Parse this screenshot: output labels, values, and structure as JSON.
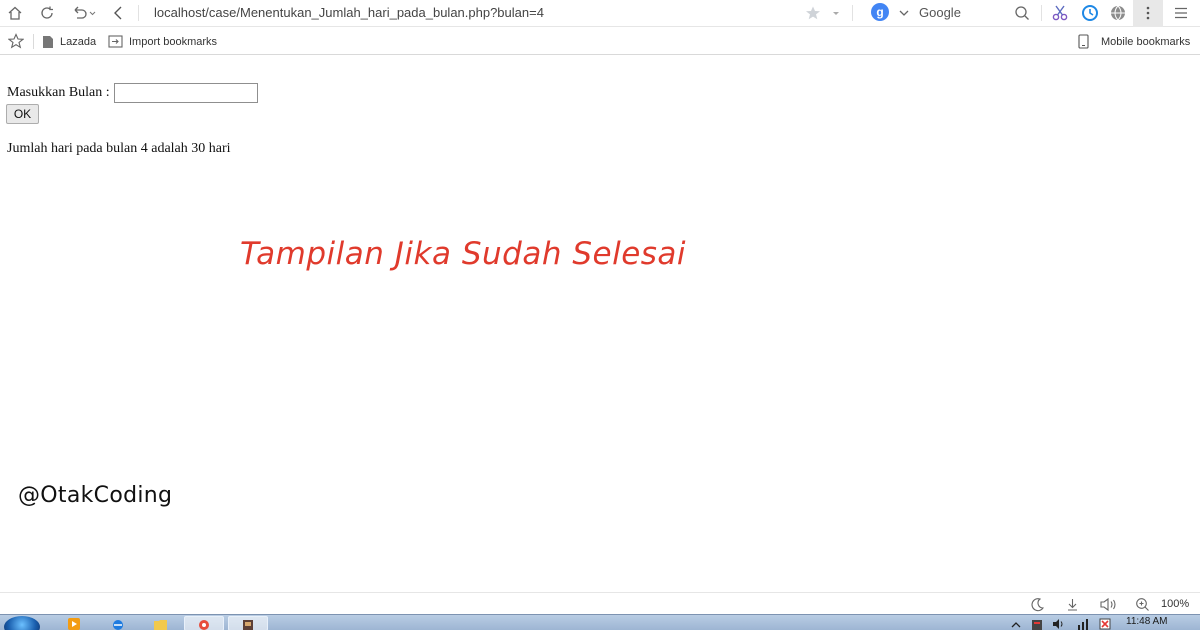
{
  "browser": {
    "url": "localhost/case/Menentukan_Jumlah_hari_pada_bulan.php?bulan=4",
    "search_engine": "Google",
    "search_logo_letter": "g",
    "accent_color": "#4285f4"
  },
  "bookmarks": {
    "items": [
      {
        "label": "Lazada",
        "icon": "page-icon"
      },
      {
        "label": "Import bookmarks",
        "icon": "import-icon"
      }
    ],
    "mobile_label": "Mobile bookmarks"
  },
  "page": {
    "form_label": "Masukkan Bulan :",
    "input_value": "",
    "ok_label": "OK",
    "result_text": "Jumlah hari pada bulan 4 adalah 30 hari",
    "headline": "Tampilan Jika Sudah Selesai",
    "headline_color": "#e03a2c",
    "watermark": "@OtakCoding"
  },
  "statusbar": {
    "zoom": "100%"
  },
  "taskbar": {
    "clock": "11:48 AM"
  }
}
